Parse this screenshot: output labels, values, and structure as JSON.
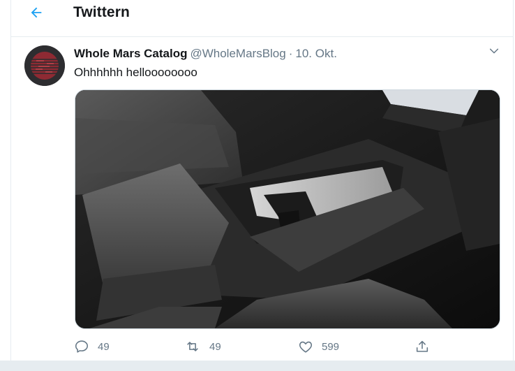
{
  "header": {
    "back_icon": "arrow-left-icon",
    "title": "Twittern",
    "accent_color": "#1da1f2"
  },
  "tweet": {
    "author": {
      "display_name": "Whole Mars Catalog",
      "handle": "@WholeMarsBlog",
      "separator": "·",
      "date": "10. Okt."
    },
    "menu_icon": "chevron-down-icon",
    "text": "Ohhhhhh helloooooooo",
    "media": {
      "icon": "car-interior-photo"
    },
    "actions": {
      "reply": {
        "icon": "reply-icon",
        "count": "49"
      },
      "retweet": {
        "icon": "retweet-icon",
        "count": "49"
      },
      "like": {
        "icon": "heart-icon",
        "count": "599"
      },
      "share": {
        "icon": "share-icon"
      }
    }
  },
  "colors": {
    "text_primary": "#14171a",
    "text_secondary": "#657786",
    "border": "#e6ecf0"
  }
}
